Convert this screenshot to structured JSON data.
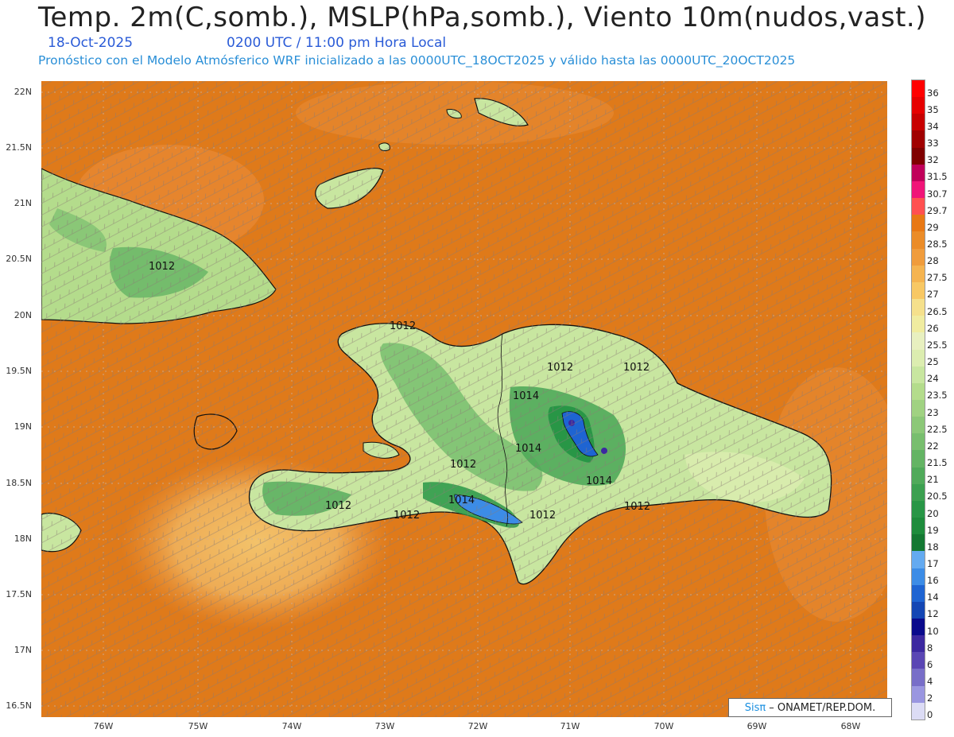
{
  "header": {
    "title": "Temp. 2m(C,somb.), MSLP(hPa,somb.), Viento 10m(nudos,vast.)",
    "date": "18-Oct-2025",
    "time": "0200 UTC / 11:00 pm Hora Local",
    "model_line": "Pronóstico con el Modelo Atmósferico WRF inicializado a las 0000UTC_18OCT2025 y válido hasta las  0000UTC_20OCT2025"
  },
  "axes": {
    "lat_labels": [
      "22N",
      "21.5N",
      "21N",
      "20.5N",
      "20N",
      "19.5N",
      "19N",
      "18.5N",
      "18N",
      "17.5N",
      "17N",
      "16.5N"
    ],
    "lon_labels": [
      "76W",
      "75W",
      "74W",
      "73W",
      "72W",
      "71W",
      "70W",
      "69W",
      "68W"
    ]
  },
  "isobars": {
    "labels": [
      "1012",
      "1012",
      "1012",
      "1012",
      "1014",
      "1014",
      "1012",
      "1014",
      "1012",
      "1012",
      "1014",
      "1012",
      "1012"
    ]
  },
  "colorbar": {
    "labels": [
      "36",
      "35",
      "34",
      "33",
      "32",
      "31.5",
      "30.7",
      "29.7",
      "29",
      "28.5",
      "28",
      "27.5",
      "27",
      "26.5",
      "26",
      "25.5",
      "25",
      "24",
      "23.5",
      "23",
      "22.5",
      "22",
      "21.5",
      "21",
      "20.5",
      "20",
      "19",
      "18",
      "17",
      "16",
      "14",
      "12",
      "10",
      "8",
      "6",
      "4",
      "2",
      "0"
    ],
    "colors": [
      "#ff0000",
      "#e60000",
      "#c80000",
      "#a00000",
      "#800000",
      "#c0005a",
      "#f01478",
      "#ff5050",
      "#e87814",
      "#eb8c28",
      "#f09c3c",
      "#f5b450",
      "#f8c864",
      "#f5e08c",
      "#f0eca0",
      "#e8f0c0",
      "#dcedb0",
      "#c8e6a0",
      "#b4dc8c",
      "#a0d282",
      "#8cc878",
      "#78be6e",
      "#64b464",
      "#50aa5a",
      "#3ca050",
      "#289646",
      "#1e8c3c",
      "#147832",
      "#64aaf0",
      "#3c8ce6",
      "#1e64d2",
      "#1446b4",
      "#0a0a8c",
      "#3c28a0",
      "#5a46b4",
      "#786ec8",
      "#9a96e0",
      "#dcdcf5"
    ]
  },
  "credit": {
    "brand": "Sisπ",
    "org": "– ONAMET/REP.DOM."
  }
}
